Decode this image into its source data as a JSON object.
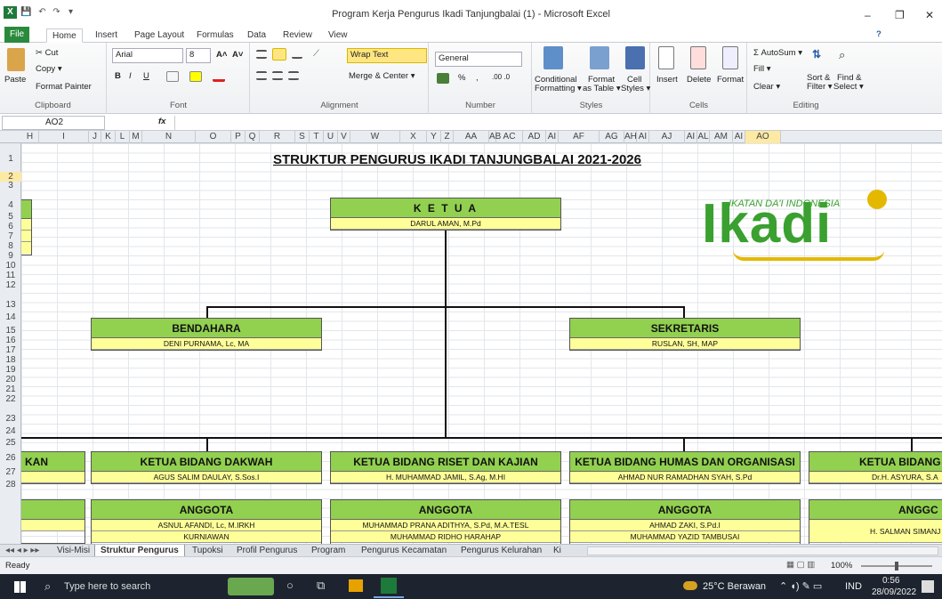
{
  "window": {
    "title": "Program Kerja Pengurus Ikadi Tanjungbalai (1)  -  Microsoft Excel",
    "min": "–",
    "max": "❐",
    "close": "✕",
    "quick_access": [
      "💾",
      "↶",
      "↷",
      "▾"
    ],
    "help": "?"
  },
  "tabs": [
    "File",
    "Home",
    "Insert",
    "Page Layout",
    "Formulas",
    "Data",
    "Review",
    "View"
  ],
  "ribbon": {
    "clipboard": {
      "paste": "Paste",
      "cut": "Cut",
      "copy": "Copy ▾",
      "format_painter": "Format Painter",
      "label": "Clipboard"
    },
    "font": {
      "name": "Arial",
      "size": "8",
      "label": "Font",
      "bold": "B",
      "italic": "I",
      "underline": "U",
      "grow": "A˄",
      "shrink": "A˅"
    },
    "alignment": {
      "wrap": "Wrap Text",
      "merge": "Merge & Center ▾",
      "label": "Alignment"
    },
    "number": {
      "format": "General",
      "label": "Number",
      "percent": "%",
      "comma": ","
    },
    "styles": {
      "conditional": "Conditional",
      "conditional2": "Formatting ▾",
      "format_table": "Format",
      "format_table2": "as Table ▾",
      "cell_styles": "Cell",
      "cell_styles2": "Styles ▾",
      "label": "Styles"
    },
    "cells": {
      "insert": "Insert",
      "delete": "Delete",
      "format": "Format",
      "label": "Cells"
    },
    "editing": {
      "autosum": "Σ AutoSum ▾",
      "fill": "Fill ▾",
      "clear": "Clear ▾",
      "sort": "Sort &",
      "sort2": "Filter ▾",
      "find": "Find &",
      "find2": "Select ▾",
      "label": "Editing"
    }
  },
  "formula_bar": {
    "name_box": "AO2",
    "fx": "fx",
    "value": ""
  },
  "columns": [
    "H",
    "I",
    "J",
    "K",
    "L",
    "M",
    "N",
    "O",
    "P",
    "Q",
    "R",
    "S",
    "T",
    "U",
    "V",
    "W",
    "X",
    "Y",
    "Z",
    "AA",
    "AB",
    "AC",
    "AD",
    "AI",
    "AF",
    "AG",
    "AH",
    "AI",
    "AJ",
    "AI",
    "AL",
    "AM",
    "AI",
    "AO"
  ],
  "rows": [
    "1",
    "2",
    "3",
    "4",
    "5",
    "6",
    "7",
    "8",
    "9",
    "10",
    "11",
    "12",
    "13",
    "14",
    "15",
    "16",
    "17",
    "18",
    "19",
    "20",
    "21",
    "22",
    "23",
    "24",
    "25",
    "26",
    "27",
    "28"
  ],
  "sheet": {
    "title": "STRUKTUR PENGURUS IKADI TANJUNGBALAI 2021-2026",
    "logo_tagline": "IKATAN DA'I INDONESIA",
    "logo_text": "Ikadi",
    "ketua": {
      "role": "K E T U A",
      "name": "DARUL AMAN, M.Pd"
    },
    "bendahara": {
      "role": "BENDAHARA",
      "name": "DENI PURNAMA, Lc, MA"
    },
    "sekretaris": {
      "role": "SEKRETARIS",
      "name": "RUSLAN, SH, MAP"
    },
    "left_partial": "KAN",
    "dakwah": {
      "role": "KETUA BIDANG DAKWAH",
      "name": "AGUS SALIM DAULAY, S.Sos.I",
      "anggota": "ANGGOTA",
      "m1": "ASNUL AFANDI, Lc, M.IRKH",
      "m2": "KURNIAWAN"
    },
    "riset": {
      "role": "KETUA BIDANG RISET DAN KAJIAN",
      "name": "H. MUHAMMAD JAMIL, S.Ag, M.HI",
      "anggota": "ANGGOTA",
      "m1": "MUHAMMAD PRANA ADITHYA, S.Pd, M.A.TESL",
      "m2": "MUHAMMAD RIDHO HARAHAP"
    },
    "humas": {
      "role": "KETUA BIDANG HUMAS DAN ORGANISASI",
      "name": "AHMAD NUR RAMADHAN SYAH, S.Pd",
      "anggota": "ANGGOTA",
      "m1": "AHMAD ZAKI, S.Pd.I",
      "m2": "MUHAMMAD YAZID TAMBUSAI"
    },
    "right_partial": {
      "role": "KETUA BIDANG",
      "name": "Dr.H. ASYURA, S.A",
      "anggota": "ANGGC",
      "m1": "H. SALMAN SIMANJ"
    }
  },
  "sheet_tabs": [
    "Visi-Misi",
    "Struktur Pengurus",
    "Tupoksi",
    "Profil Pengurus",
    "Program",
    "Pengurus Kecamatan",
    "Pengurus Kelurahan",
    "Ki"
  ],
  "status": {
    "ready": "Ready",
    "zoom": "100%"
  },
  "taskbar": {
    "search": "Type here to search",
    "weather": "25°C  Berawan",
    "lang": "IND",
    "time": "0:56",
    "date": "28/09/2022"
  },
  "colors": {
    "header_green": "#92d050",
    "name_yellow": "#ffff99",
    "file_tab": "#2a8a3c",
    "logo_green": "#3aa02f",
    "logo_gold": "#e5b800"
  }
}
